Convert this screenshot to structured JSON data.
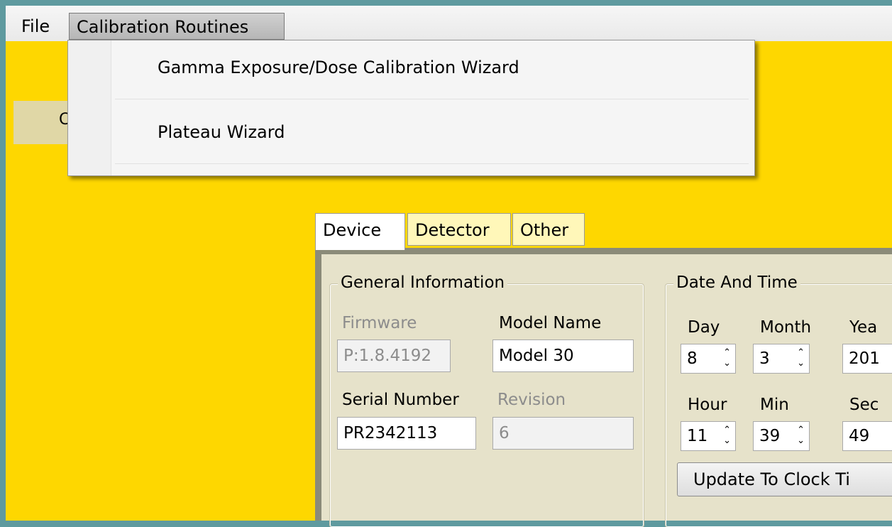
{
  "menu": {
    "file": "File",
    "calibration": "Calibration Routines",
    "dropdown": [
      {
        "label": "Gamma Exposure/Dose Calibration Wizard"
      },
      {
        "label": "Plateau Wizard"
      }
    ]
  },
  "background_button": {
    "label": "C"
  },
  "tabs": [
    {
      "label": "Device",
      "active": true
    },
    {
      "label": "Detector",
      "active": false
    },
    {
      "label": "Other",
      "active": false
    }
  ],
  "general": {
    "title": "General Information",
    "firmware_label": "Firmware",
    "firmware_value": "P:1.8.4192",
    "model_label": "Model Name",
    "model_value": "Model 30",
    "serial_label": "Serial Number",
    "serial_value": "PR2342113",
    "revision_label": "Revision",
    "revision_value": "6"
  },
  "datetime": {
    "title": "Date And Time",
    "day_label": "Day",
    "month_label": "Month",
    "year_label": "Yea",
    "day_value": "8",
    "month_value": "3",
    "year_value": "201",
    "hour_label": "Hour",
    "min_label": "Min",
    "sec_label": "Sec",
    "hour_value": "11",
    "min_value": "39",
    "sec_value": "49",
    "update_button": "Update To Clock Ti"
  },
  "colors": {
    "window_bg": "#fed700",
    "frame": "#5f9a9f",
    "panel_bg": "#e6e2ca",
    "inactive_tab": "#fff7b9"
  },
  "icons": {
    "spin_up": "chevron-up-icon",
    "spin_down": "chevron-down-icon"
  }
}
